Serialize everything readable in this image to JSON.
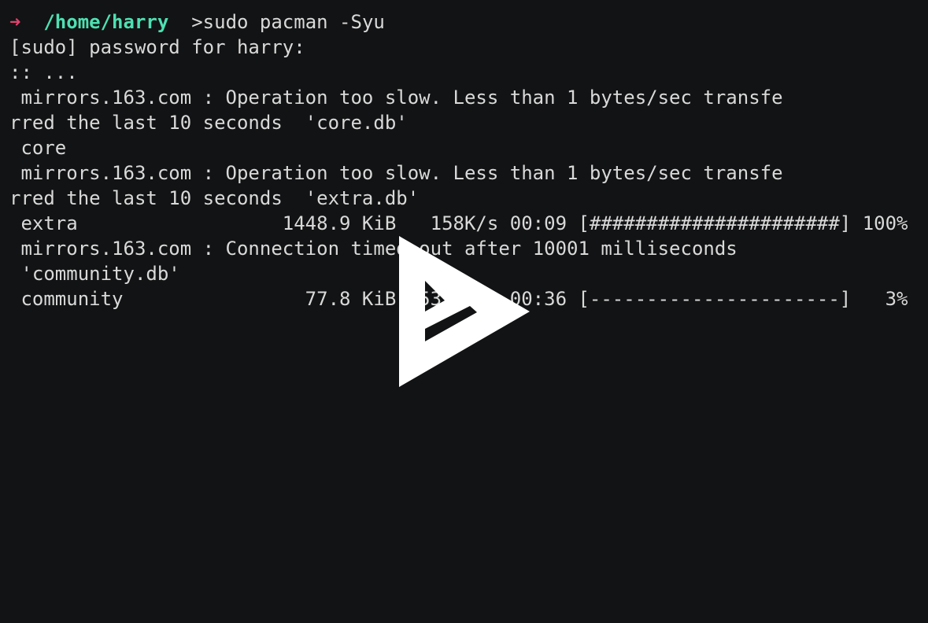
{
  "prompt": {
    "arrow": "➜",
    "cwd": "/home/harry",
    "command": " >sudo pacman -Syu"
  },
  "lines": [
    "[sudo] password for harry:",
    ":: ...",
    " mirrors.163.com : Operation too slow. Less than 1 bytes/sec transfe",
    "rred the last 10 seconds  'core.db'",
    " core",
    " mirrors.163.com : Operation too slow. Less than 1 bytes/sec transfe",
    "rred the last 10 seconds  'extra.db'",
    " extra                  1448.9 KiB   158K/s 00:09 [######################] 100%",
    " mirrors.163.com : Connection timed out after 10001 milliseconds",
    " 'community.db'",
    " community                77.8 KiB  53.8K/s 00:36 [----------------------]   3%"
  ],
  "overlay": {
    "icon": "play-icon",
    "fill_color": "#ffffff"
  },
  "colors": {
    "background": "#121314",
    "text": "#d9d9d9",
    "arrow": "#e0426e",
    "path": "#4ee0b2"
  }
}
